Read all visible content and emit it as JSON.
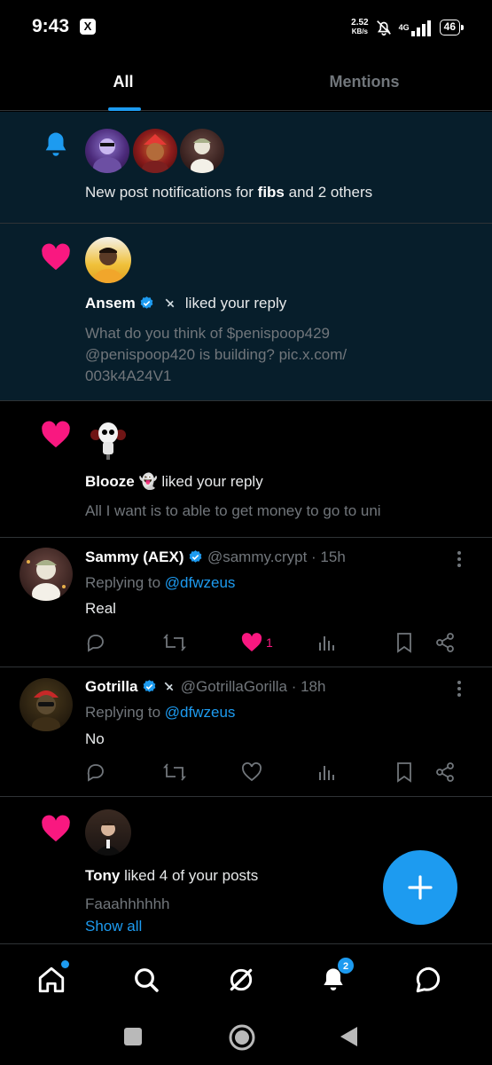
{
  "status_bar": {
    "time": "9:43",
    "x_icon_label": "X",
    "speed_value": "2.52",
    "speed_unit": "KB/s",
    "network": "4G",
    "battery": "46"
  },
  "tabs": [
    {
      "label": "All",
      "active": true
    },
    {
      "label": "Mentions",
      "active": false
    }
  ],
  "notifications": {
    "post_notif": {
      "icon": "bell-icon",
      "text_before": "New post notifications for ",
      "name": "fibs",
      "text_after": " and 2 others"
    },
    "ansem_like": {
      "icon": "heart-icon",
      "name": "Ansem",
      "action": "liked your reply",
      "line1": "What do you think of $penispoop429",
      "line2": "@penispoop420 is building? pic.x.com/",
      "line3": "003k4A24V1"
    },
    "blooze_like": {
      "icon": "heart-icon",
      "name": "Blooze",
      "emoji": "👻",
      "action": "liked your reply",
      "snippet": "All I want is to able to get money to go to uni"
    },
    "sammy_reply": {
      "name": "Sammy (AEX)",
      "handle": "@sammy.crypt",
      "time": "· 15h",
      "replying_prefix": "Replying to",
      "replying_to": "@dfwzeus",
      "text": "Real",
      "like_count": "1"
    },
    "gotrilla_reply": {
      "name": "Gotrilla",
      "handle": "@GotrillaGorilla",
      "time": "· 18h",
      "replying_prefix": "Replying to",
      "replying_to": "@dfwzeus",
      "text": "No"
    },
    "tony_like": {
      "icon": "heart-icon",
      "name": "Tony",
      "action": "liked 4 of your posts",
      "snippet": "Faaahhhhhh",
      "show_all": "Show all"
    }
  },
  "bottom_nav": {
    "items": [
      "home-icon",
      "search-icon",
      "grok-icon",
      "notifications-icon",
      "messages-icon"
    ],
    "notifications_badge": "2"
  },
  "colors": {
    "accent": "#1d9bf0",
    "like": "#f91880",
    "unread_bg": "#071e2b",
    "muted": "#71767b"
  }
}
